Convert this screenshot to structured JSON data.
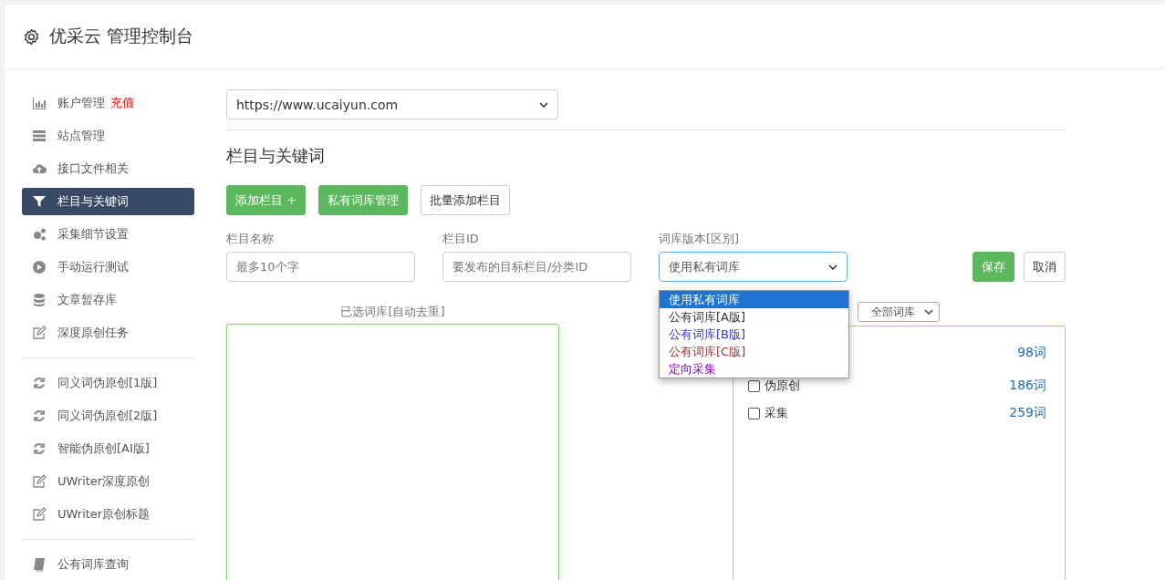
{
  "header": {
    "title": "优采云 管理控制台"
  },
  "sidebar": {
    "groups": [
      [
        {
          "label": "账户管理",
          "badge": "充值",
          "selected": false
        },
        {
          "label": "站点管理",
          "selected": false
        },
        {
          "label": "接口文件相关",
          "selected": false
        },
        {
          "label": "栏目与关键词",
          "selected": true
        },
        {
          "label": "采集细节设置",
          "selected": false
        },
        {
          "label": "手动运行测试",
          "selected": false
        },
        {
          "label": "文章暂存库",
          "selected": false
        },
        {
          "label": "深度原创任务",
          "selected": false
        }
      ],
      [
        {
          "label": "同义词伪原创[1版]",
          "selected": false
        },
        {
          "label": "同义词伪原创[2版]",
          "selected": false
        },
        {
          "label": "智能伪原创[AI版]",
          "selected": false
        },
        {
          "label": "UWriter深度原创",
          "selected": false
        },
        {
          "label": "UWriter原创标题",
          "selected": false
        }
      ],
      [
        {
          "label": "公有词库查询",
          "selected": false
        }
      ]
    ]
  },
  "main": {
    "site_select": {
      "value": "https://www.ucaiyun.com"
    },
    "section_title": "栏目与关键词",
    "buttons": [
      {
        "label": "添加栏目 +",
        "kind": "primary"
      },
      {
        "label": "私有词库管理",
        "kind": "primary"
      },
      {
        "label": "批量添加栏目",
        "kind": "default"
      }
    ],
    "form": {
      "column_name": {
        "label": "栏目名称",
        "placeholder": "最多10个字"
      },
      "column_id": {
        "label": "栏目ID",
        "placeholder": "要发布的目标栏目/分类ID"
      },
      "library_version": {
        "label": "词库版本[区别]",
        "value": "使用私有词库",
        "expanded": true,
        "options": [
          {
            "label": "使用私有词库",
            "selected": true
          },
          {
            "label": "公有词库[A版]",
            "selected": false,
            "color": "#333333"
          },
          {
            "label": "公有词库[B版]",
            "selected": false,
            "color": "#3333cc"
          },
          {
            "label": "公有词库[C版]",
            "selected": false,
            "color": "#993333"
          },
          {
            "label": "定向采集",
            "selected": false,
            "color": "#8800cc"
          }
        ]
      },
      "save": "保存",
      "cancel": "取消"
    },
    "selected_libraries": {
      "label": "已选词库[自动去重]"
    },
    "library_list": {
      "filter": "全部词库",
      "rows": [
        {
          "count": "98词"
        },
        {
          "label": "伪原创",
          "checked": false,
          "count": "186词"
        },
        {
          "label": "采集",
          "checked": false,
          "count": "259词"
        }
      ]
    }
  }
}
